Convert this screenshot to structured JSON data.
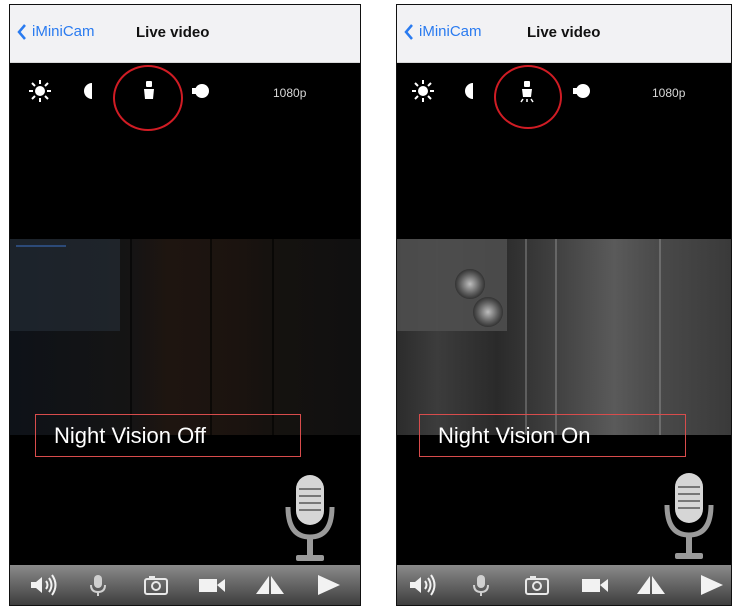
{
  "nav": {
    "back_label": "iMiniCam",
    "title": "Live video"
  },
  "controls": {
    "resolution": "1080p"
  },
  "panels": [
    {
      "state": "off",
      "caption": "Night Vision Off"
    },
    {
      "state": "on",
      "caption": "Night Vision On"
    }
  ],
  "colors": {
    "accent": "#2a7bf0",
    "highlight_ring": "#d01c24",
    "caption_border": "#d84c4c"
  },
  "toolbar_icons": [
    "speaker-icon",
    "microphone-icon",
    "camera-icon",
    "video-record-icon",
    "flip-icon",
    "play-icon"
  ]
}
